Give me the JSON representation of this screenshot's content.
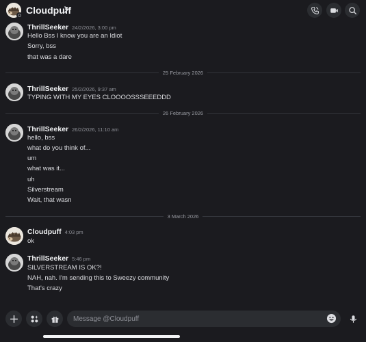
{
  "header": {
    "title": "Cloudpuff",
    "icons": [
      "call-icon",
      "video-icon",
      "search-icon"
    ]
  },
  "groups": [
    {
      "author": "ThrillSeeker",
      "timestamp": "24/2/2026, 3:00 pm",
      "lines": [
        "Hello Bss I know you are an Idiot",
        "Sorry, bss",
        "that was a dare"
      ]
    },
    {
      "author": "ThrillSeeker",
      "timestamp": "25/2/2026, 9:37 am",
      "lines": [
        "TYPING WITH MY EYES CLOOOOSSSEEEDDD"
      ]
    },
    {
      "author": "ThrillSeeker",
      "timestamp": "26/2/2026, 11:10 am",
      "lines": [
        "hello, bss",
        "what do you think of...",
        "um",
        "what was it...",
        "uh",
        "Silverstream",
        "Wait, that wasn"
      ]
    },
    {
      "author": "Cloudpuff",
      "timestamp": "4:03 pm",
      "lines": [
        "ok"
      ]
    },
    {
      "author": "ThrillSeeker",
      "timestamp": "5:46 pm",
      "lines": [
        "SILVERSTREAM IS OK?!",
        "NAH, nah. I'm sending this to Sweezy community",
        "That's crazy"
      ]
    }
  ],
  "dividers": [
    "25 February 2026",
    "26 February 2026",
    "3 March 2026"
  ],
  "composer": {
    "placeholder": "Message @Cloudpuff"
  },
  "colors": {
    "background": "#1b1b1f",
    "surface": "#2b2d31",
    "text": "#dcdde1",
    "muted": "#8f9198"
  }
}
